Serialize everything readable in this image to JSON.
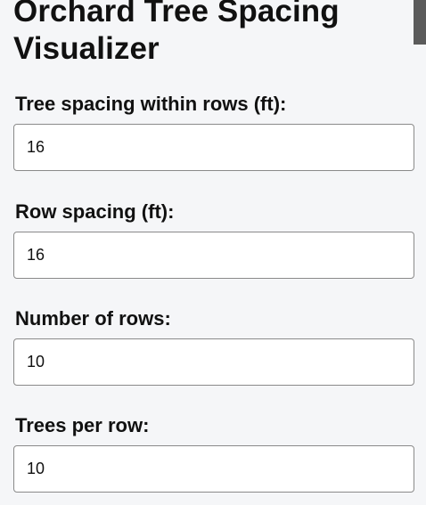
{
  "page": {
    "title": "Orchard Tree Spacing Visualizer"
  },
  "form": {
    "fields": [
      {
        "label": "Tree spacing within rows (ft):",
        "value": "16"
      },
      {
        "label": "Row spacing (ft):",
        "value": "16"
      },
      {
        "label": "Number of rows:",
        "value": "10"
      },
      {
        "label": "Trees per row:",
        "value": "10"
      }
    ]
  }
}
